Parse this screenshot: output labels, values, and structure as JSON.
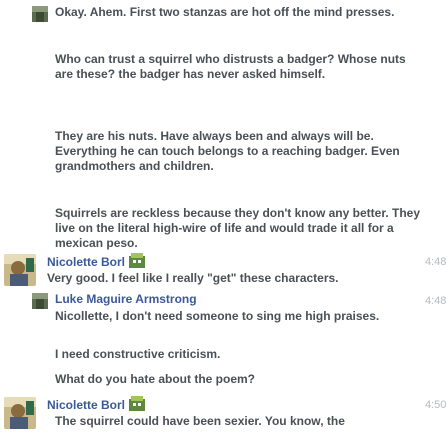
{
  "messages": [
    {
      "author": "",
      "time": "",
      "lines": [
        "Okay. Ahem. First two stanzas are hot off the mind presses.",
        "Who can trust a squirrel who distrusts a badger? Whose nuts are these? the badger has never asked himself.",
        "They are his nuts. Have always been and always will be. Everything he can touch belongs to a reaching badger. Even grandmothers and children.",
        "Squirrels are reckless because they don't know any better. They live on the literal high-wire of life and would trade it all for a mexican peso."
      ]
    },
    {
      "author": "Nicolette Borl",
      "time": "4:48",
      "lines": [
        "Very good. I feel like I really \"get\" these characters."
      ]
    },
    {
      "author": "Luke Maguire Armstrong",
      "time": "4:48",
      "lines": [
        "Nicollette, I don't need someone to sing me high praises.",
        "I need constructive criticism.",
        "What do you hate about the poem?"
      ]
    },
    {
      "author": "Nicolette Borl",
      "time": "4:50",
      "lines": [
        "The squirrel could have been sexier. You know, the"
      ]
    }
  ],
  "colors": {
    "name_link": "#3b5998",
    "text": "#4b4f56",
    "timestamp": "#b6b9be"
  }
}
